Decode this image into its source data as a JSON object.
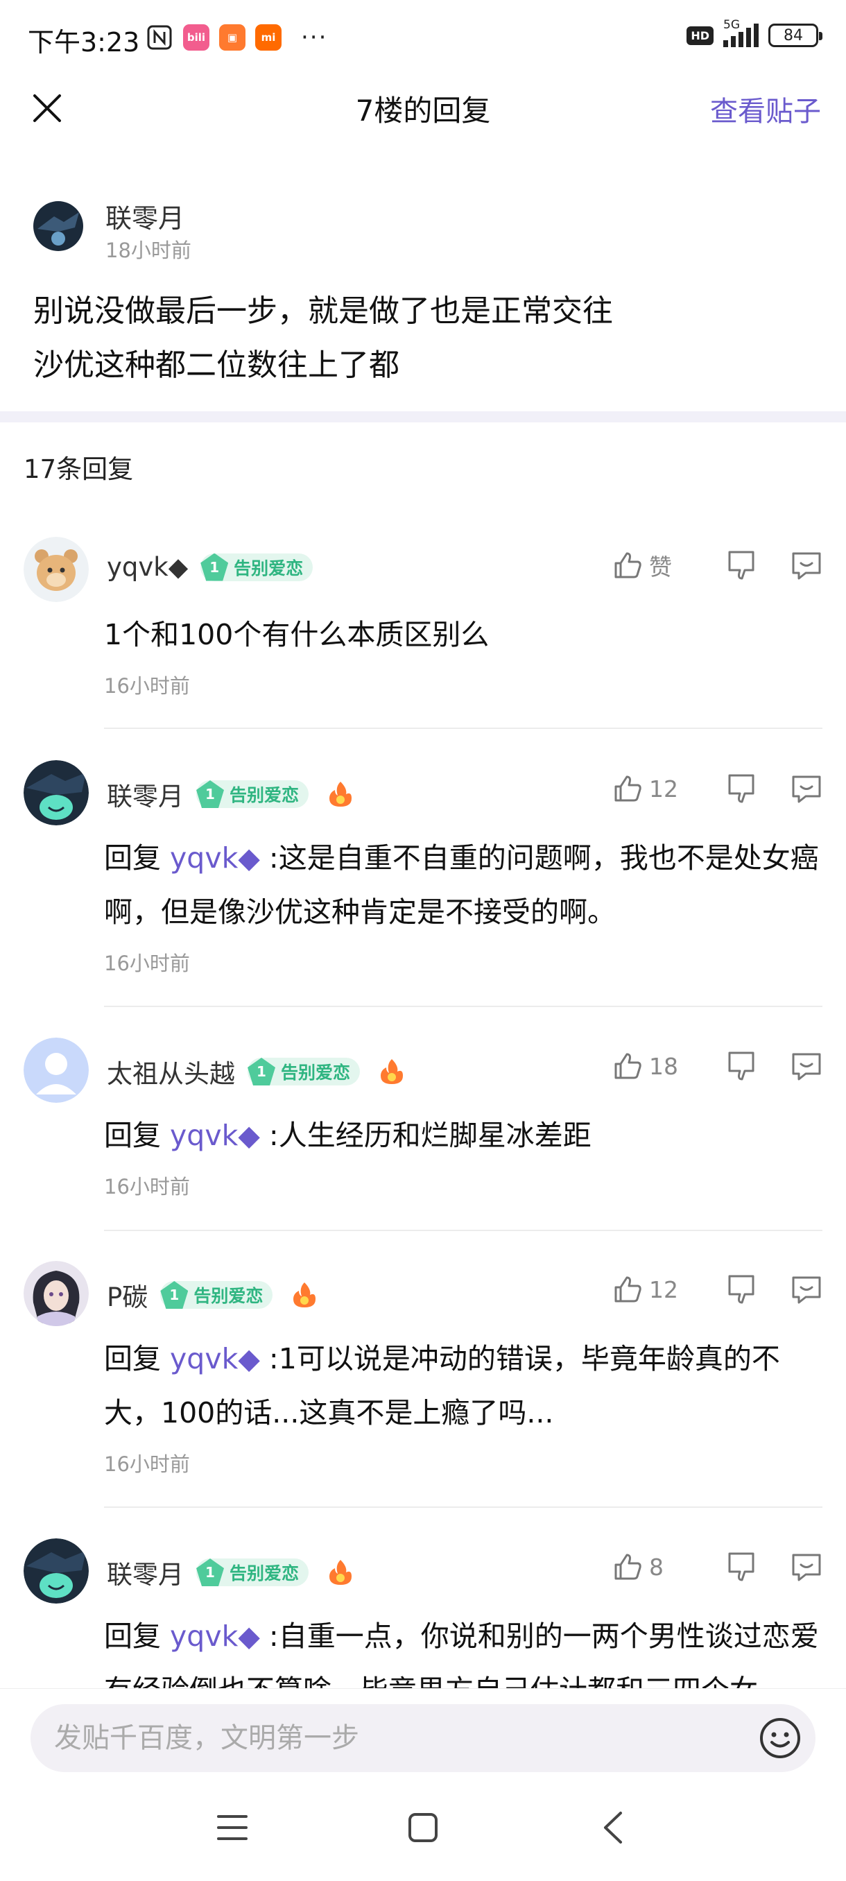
{
  "status_bar": {
    "time": "下午3:23",
    "network": "5G",
    "battery": "84",
    "more": "···"
  },
  "nav": {
    "title": "7楼的回复",
    "action": "查看贴子"
  },
  "post": {
    "user": "联零月",
    "time": "18小时前",
    "line1": "别说没做最后一步，就是做了也是正常交往",
    "line2": "沙优这种都二位数往上了都"
  },
  "reply_count": "17条回复",
  "badge": {
    "level": "1",
    "label": "告别爱恋"
  },
  "comments": [
    {
      "name": "yqvk◆",
      "likes": "赞",
      "text": "1个和100个有什么本质区别么",
      "reply_prefix": "",
      "mention": "",
      "time": "16小时前"
    },
    {
      "name": "联零月",
      "likes": "12",
      "reply_prefix": "回复",
      "mention": "yqvk◆",
      "text": ":这是自重不自重的问题啊，我也不是处女癌啊，但是像沙优这种肯定是不接受的啊。",
      "time": "16小时前"
    },
    {
      "name": "太祖从头越",
      "likes": "18",
      "reply_prefix": "回复",
      "mention": "yqvk◆",
      "text": ":人生经历和烂脚星冰差距",
      "time": "16小时前"
    },
    {
      "name": "P碳",
      "likes": "12",
      "reply_prefix": "回复",
      "mention": "yqvk◆",
      "text": ":1可以说是冲动的错误，毕竟年龄真的不大，100的话...这真不是上瘾了吗...",
      "time": "16小时前"
    },
    {
      "name": "联零月",
      "likes": "8",
      "reply_prefix": "回复",
      "mention": "yqvk◆",
      "text": ":自重一点，你说和别的一两个男性谈过恋爱有经验倒也不算啥，毕竟男方自己估计都和三四个女",
      "time": ""
    }
  ],
  "input": {
    "placeholder": "发贴千百度，文明第一步"
  },
  "colors": {
    "accent": "#6a5acd",
    "badge_green": "#4fcb9b",
    "band": "#f1f0f8"
  }
}
